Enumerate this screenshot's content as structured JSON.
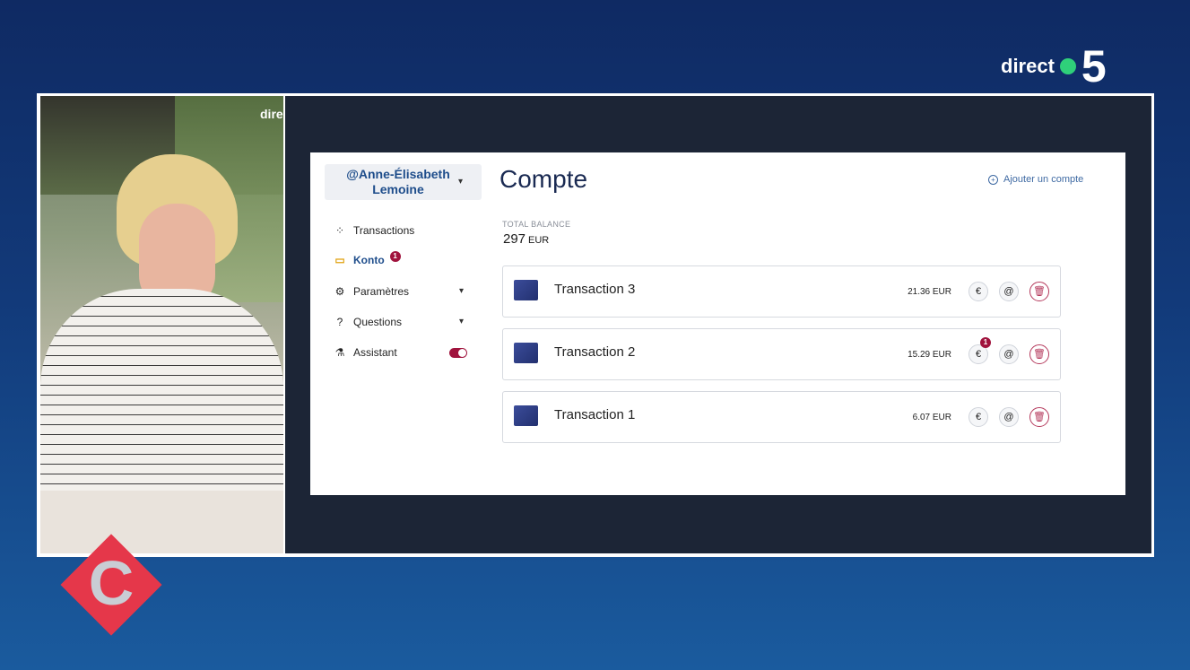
{
  "channel": {
    "direct_label": "direct",
    "number": "5",
    "dot_color": "#2fd07a"
  },
  "video": {
    "cam_label": "dire"
  },
  "show_logo": {
    "letter": "C",
    "color": "#e5374a"
  },
  "sidebar": {
    "user": "@Anne-Élisabeth Lemoine",
    "items": [
      {
        "label": "Transactions",
        "icon": "grid-icon"
      },
      {
        "label": "Konto",
        "icon": "wallet-icon",
        "badge": "1",
        "active": true
      },
      {
        "label": "Paramètres",
        "icon": "gear-icon"
      },
      {
        "label": "Questions",
        "icon": "help-circle-icon"
      },
      {
        "label": "Assistant",
        "icon": "flask-icon",
        "toggle_on": true
      }
    ]
  },
  "main": {
    "title": "Compte",
    "add_account": "Ajouter un compte",
    "balance_label": "TOTAL BALANCE",
    "balance_amount": "297",
    "balance_currency": "EUR",
    "transactions": [
      {
        "name": "Transaction 3",
        "amount": "21.36 EUR"
      },
      {
        "name": "Transaction 2",
        "amount": "15.29 EUR",
        "badge": "1"
      },
      {
        "name": "Transaction 1",
        "amount": "6.07 EUR"
      }
    ]
  },
  "colors": {
    "accent": "#a0133d",
    "title": "#1a2a52",
    "link": "#3f6aa3",
    "user": "#1e4d8b",
    "konto_active": "#e0a313"
  }
}
